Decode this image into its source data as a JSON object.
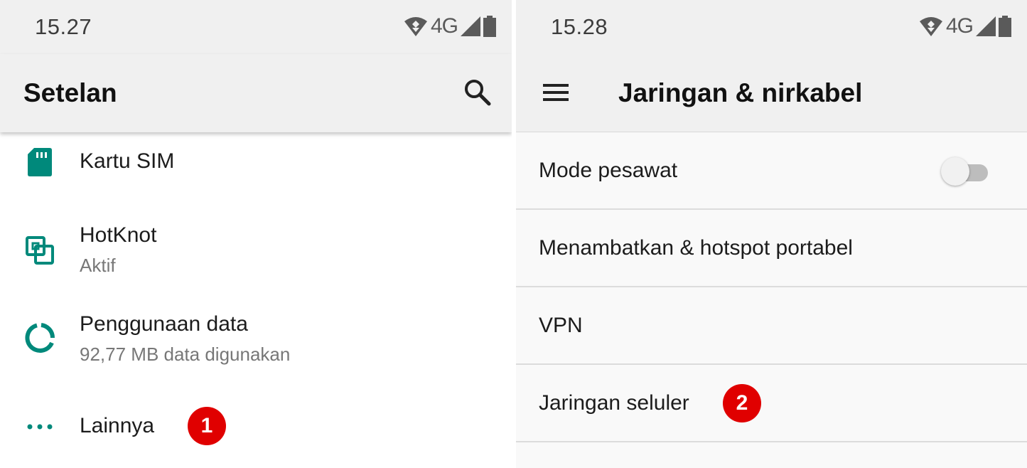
{
  "left_screen": {
    "status_bar": {
      "time": "15.27",
      "network_label": "4G",
      "icons": [
        "wifi-icon",
        "signal-icon",
        "battery-icon"
      ]
    },
    "header": {
      "title": "Setelan",
      "action_icon": "search-icon"
    },
    "items": [
      {
        "title": "Kartu SIM",
        "subtitle": "",
        "icon": "sim-card-icon"
      },
      {
        "title": "HotKnot",
        "subtitle": "Aktif",
        "icon": "hotknot-icon"
      },
      {
        "title": "Penggunaan data",
        "subtitle": "92,77 MB data digunakan",
        "icon": "data-usage-icon"
      },
      {
        "title": "Lainnya",
        "subtitle": "",
        "icon": "more-dots-icon",
        "badge": "1"
      }
    ]
  },
  "right_screen": {
    "status_bar": {
      "time": "15.28",
      "network_label": "4G",
      "icons": [
        "wifi-icon",
        "signal-icon",
        "battery-icon"
      ]
    },
    "header": {
      "title": "Jaringan & nirkabel",
      "nav_icon": "hamburger-menu-icon"
    },
    "items": [
      {
        "title": "Mode pesawat",
        "toggle_on": false
      },
      {
        "title": "Menambatkan & hotspot portabel"
      },
      {
        "title": "VPN"
      },
      {
        "title": "Jaringan seluler",
        "badge": "2"
      }
    ]
  },
  "colors": {
    "accent": "#00897b",
    "badge": "#e00000",
    "header_bg": "#f0f0f0"
  }
}
